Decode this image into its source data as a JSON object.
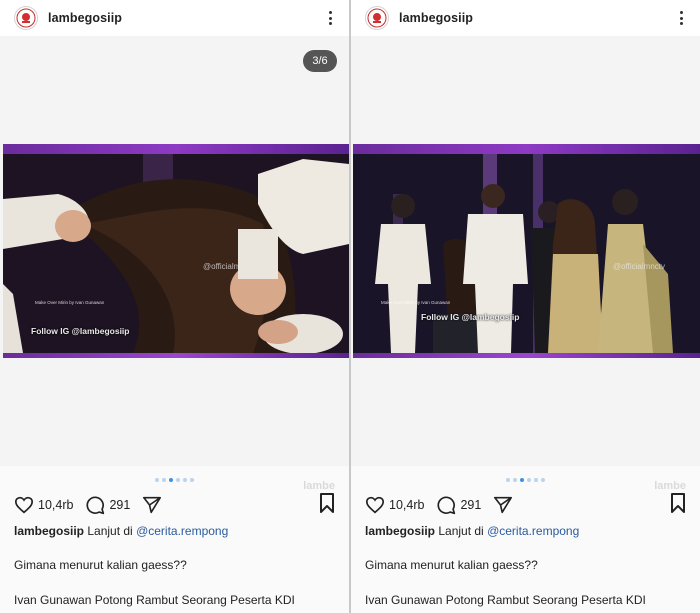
{
  "posts": [
    {
      "username": "lambegosiip",
      "slide_counter": "3/6",
      "follow_text": "Follow IG @lambegosiip",
      "video_watermark": "@officialmnctv",
      "small_watermark": "Make Over Mirin by Ivan Gunawan",
      "ghost_watermark": "lambe",
      "likes": "10,4rb",
      "comments": "291",
      "caption_username": "lambegosiip",
      "caption_text": " Lanjut di ",
      "caption_mention": "@cerita.rempong",
      "line2": "Gimana menurut kalian gaess??",
      "line3": "Ivan Gunawan Potong Rambut Seorang Peserta KDI",
      "carousel_dots": 6,
      "active_dot": 2
    },
    {
      "username": "lambegosiip",
      "follow_text": "Follow IG @lambegosiip",
      "video_watermark": "@officialmnctv",
      "small_watermark": "Make Over Mirin by Ivan Gunawan",
      "ghost_watermark": "lambe",
      "likes": "10,4rb",
      "comments": "291",
      "caption_username": "lambegosiip",
      "caption_text": " Lanjut di ",
      "caption_mention": "@cerita.rempong",
      "line2": "Gimana menurut kalian gaess??",
      "line3": "Ivan Gunawan Potong Rambut Seorang Peserta KDI",
      "carousel_dots": 6,
      "active_dot": 2
    }
  ],
  "icons": {
    "more": "more-vertical-icon",
    "like": "heart-icon",
    "comment": "comment-icon",
    "share": "send-icon",
    "save": "bookmark-icon"
  },
  "colors": {
    "mention": "#2a5a9c",
    "active_dot": "#3b94e3",
    "video_frame": "#8e3ac4"
  }
}
